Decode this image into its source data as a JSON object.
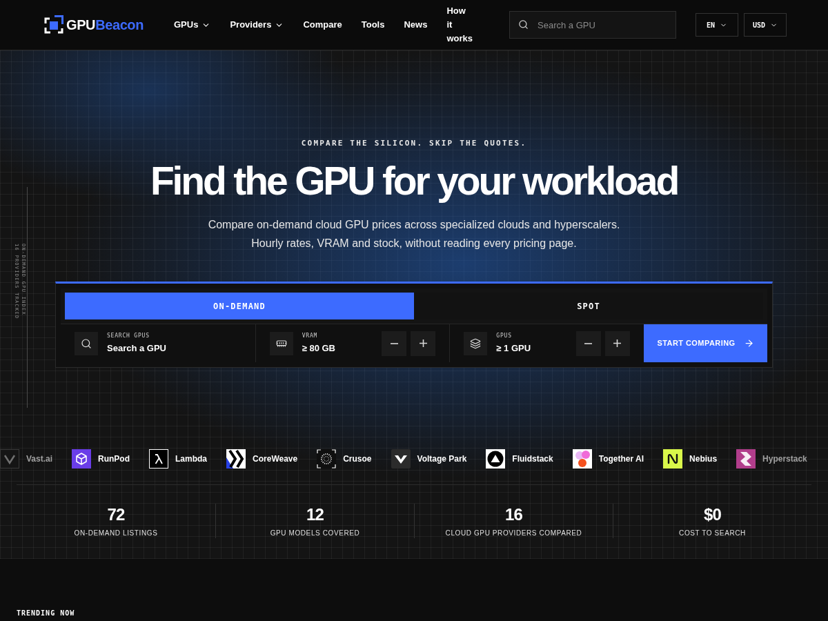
{
  "header": {
    "logo": {
      "text_1": "GPU",
      "text_2": "Beacon"
    },
    "nav": [
      {
        "label": "GPUs",
        "has_menu": true
      },
      {
        "label": "Providers",
        "has_menu": true
      },
      {
        "label": "Compare",
        "has_menu": false
      },
      {
        "label": "Tools",
        "has_menu": false
      },
      {
        "label": "News",
        "has_menu": false
      },
      {
        "label": "How it works",
        "has_menu": false
      }
    ],
    "search": {
      "placeholder": "Search a GPU"
    },
    "language": {
      "label": "EN"
    },
    "currency": {
      "label": "USD"
    }
  },
  "hero": {
    "side_caption": [
      "ON-DEMAND GPU INDEX",
      "16 PROVIDERS TRACKED"
    ],
    "eyebrow": "COMPARE THE SILICON. SKIP THE QUOTES.",
    "title": "Find the GPU for your workload",
    "subtitle": [
      "Compare on-demand cloud GPU prices across specialized clouds and hyperscalers.",
      "Hourly rates, VRAM and stock, without reading every pricing page."
    ]
  },
  "finder": {
    "tabs": [
      {
        "label": "ON-DEMAND",
        "selected": true
      },
      {
        "label": "SPOT",
        "selected": false
      }
    ],
    "fields": [
      {
        "kind": "search",
        "label": "SEARCH GPUS",
        "placeholder": "Search a GPU"
      },
      {
        "kind": "stepper",
        "label": "VRAM",
        "value": "≥ 80 GB"
      },
      {
        "kind": "stepper",
        "label": "GPUS",
        "value": "≥ 1 GPU"
      }
    ],
    "submit": "START COMPARING"
  },
  "providers": [
    {
      "name": "Vast.ai"
    },
    {
      "name": "RunPod"
    },
    {
      "name": "Lambda"
    },
    {
      "name": "CoreWeave"
    },
    {
      "name": "Crusoe"
    },
    {
      "name": "Voltage Park"
    },
    {
      "name": "Fluidstack"
    },
    {
      "name": "Together AI"
    },
    {
      "name": "Nebius"
    },
    {
      "name": "Hyperstack"
    }
  ],
  "stats": [
    {
      "value": "72",
      "label": "ON-DEMAND LISTINGS"
    },
    {
      "value": "12",
      "label": "GPU MODELS COVERED"
    },
    {
      "value": "16",
      "label": "CLOUD GPU PROVIDERS COMPARED"
    },
    {
      "value": "$0",
      "label": "COST TO SEARCH"
    }
  ],
  "trending": {
    "heading": "TRENDING NOW"
  }
}
